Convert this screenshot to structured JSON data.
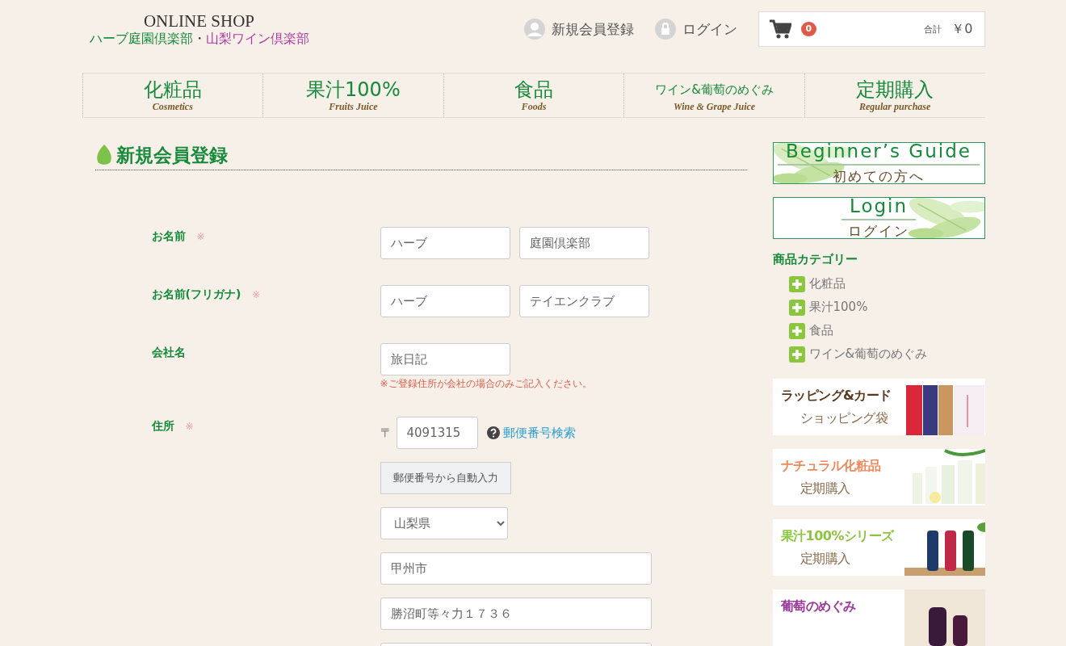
{
  "header": {
    "shop_title": "ONLINE SHOP",
    "club_1": "ハーブ庭園倶楽部",
    "separator": "・",
    "club_2": "山梨ワイン倶楽部",
    "register_link": "新規会員登録",
    "login_link": "ログイン",
    "cart": {
      "count": "0",
      "total_label": "合計",
      "total": "￥0"
    }
  },
  "nav": [
    {
      "label": "化粧品",
      "sub": "Cosmetics",
      "kind": "large"
    },
    {
      "label": "果汁100%",
      "sub": "Fruits Juice",
      "kind": "large"
    },
    {
      "label": "食品",
      "sub": "Foods",
      "kind": "large"
    },
    {
      "label": "ワイン&葡萄のめぐみ",
      "sub": "Wine & Grape Juice",
      "kind": "small"
    },
    {
      "label": "定期購入",
      "sub": "Regular purchase",
      "kind": "large"
    }
  ],
  "page_title": "新規会員登録",
  "form": {
    "rows": [
      {
        "kind": "pair",
        "label": "お名前",
        "required_mark": "※",
        "fields": [
          {
            "value": "ハーブ"
          },
          {
            "value": "庭園倶楽部"
          }
        ]
      },
      {
        "kind": "pair",
        "label": "お名前(フリガナ)",
        "required_mark": "※",
        "fields": [
          {
            "value": "ハーブ"
          },
          {
            "value": "テイエンクラブ"
          }
        ]
      },
      {
        "kind": "single",
        "label": "会社名",
        "fields": [
          {
            "value": "旅日記"
          }
        ],
        "note": "※ご登録住所が会社の場合のみご記入ください。"
      },
      {
        "kind": "address",
        "label": "住所",
        "required_mark": "※",
        "postal_mark": "〒",
        "postal": "4091315",
        "search_link": "郵便番号検索",
        "autofill_button": "郵便番号から自動入力",
        "prefecture": "山梨県",
        "lines": [
          "甲州市",
          "勝沼町等々力１７３６"
        ]
      }
    ]
  },
  "sidebar": {
    "guides": [
      {
        "title": "Beginner’s Guide",
        "subtitle": "初めての方へ",
        "kind": "left"
      },
      {
        "title": "Login",
        "subtitle": "ログイン",
        "kind": "right"
      }
    ],
    "category_heading": "商品カテゴリー",
    "categories": [
      "化粧品",
      "果汁100%",
      "食品",
      "ワイン&葡萄のめぐみ"
    ],
    "promos": [
      {
        "line_1": "ラッピング&カード",
        "line_2": "ショッピング袋",
        "color": "#5a3a1e",
        "kind": "gift"
      },
      {
        "line_1": "ナチュラル化粧品",
        "line_2": "定期購入",
        "color": "#f08a5a",
        "kind": "cosme"
      },
      {
        "line_1": "果汁100%シリーズ",
        "line_2": "定期購入",
        "color": "#8cc63f",
        "kind": "bottles"
      },
      {
        "line_1": "葡萄のめぐみ",
        "color": "#9a3a9a",
        "kind": "wine"
      }
    ]
  }
}
